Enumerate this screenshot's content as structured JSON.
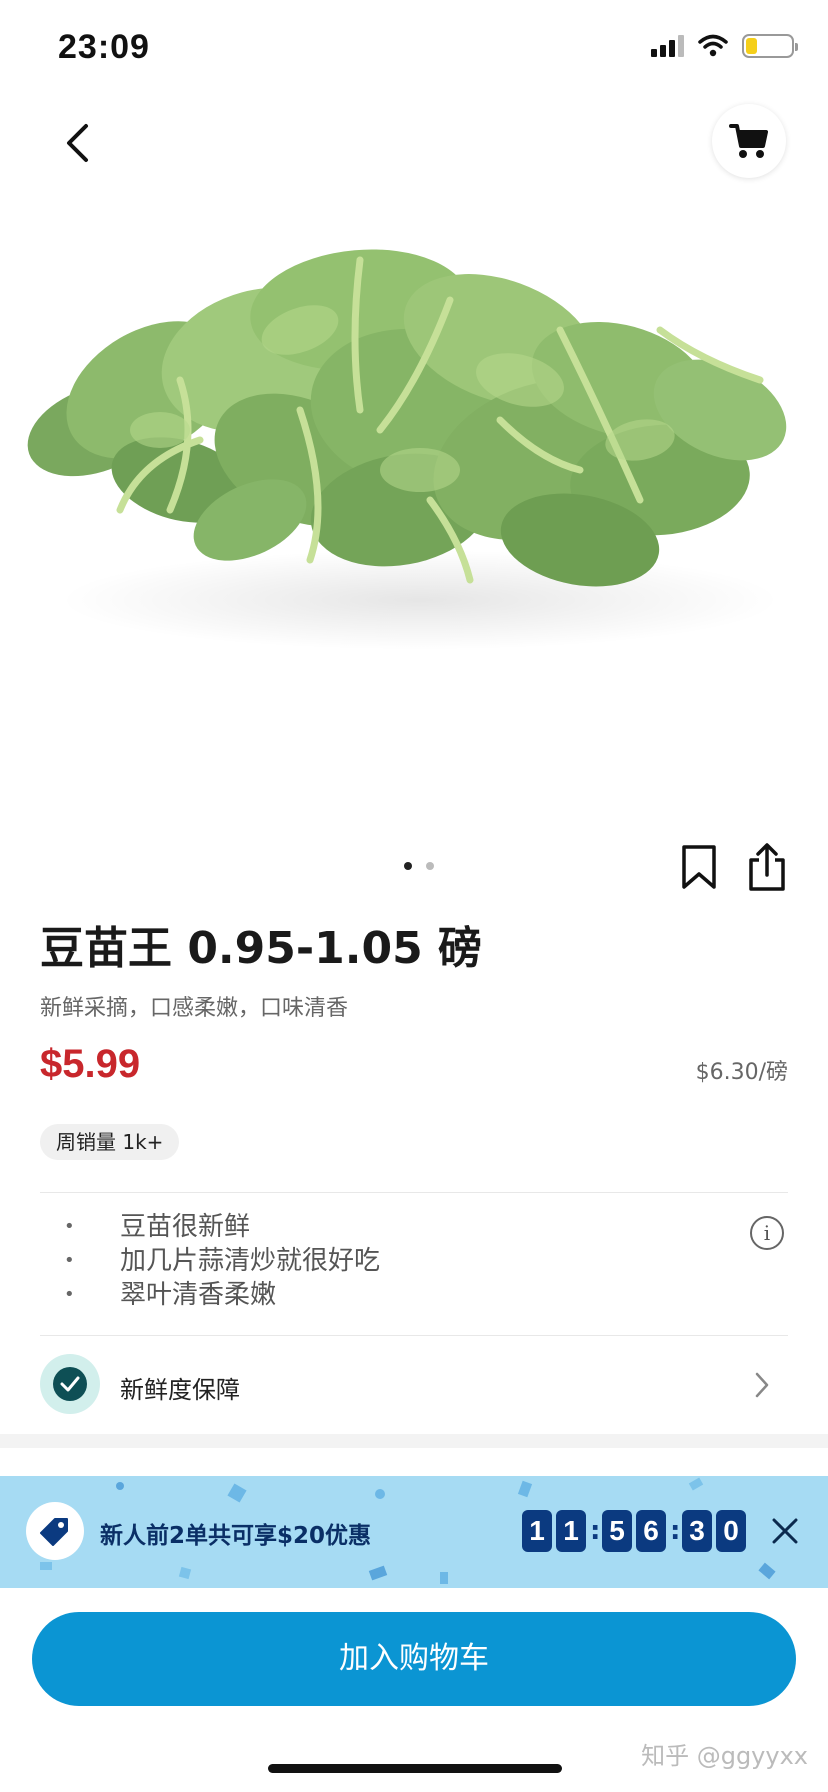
{
  "status_bar": {
    "time": "23:09",
    "icons": [
      "signal-icon",
      "wifi-icon",
      "battery-icon"
    ],
    "battery_level": 0.25,
    "battery_color": "#f5cf1a"
  },
  "nav": {
    "back_icon": "chevron-left-icon",
    "cart_icon": "shopping-cart-icon"
  },
  "product": {
    "image": "pea-shoots-photo",
    "image_count": 2,
    "image_index": 1,
    "title": "豆苗王 0.95-1.05 磅",
    "subtitle": "新鲜采摘，口感柔嫩，口味清香",
    "price": "$5.99",
    "price_color": "#c8272c",
    "unit_price": "$6.30/磅",
    "sales_badge": "周销量 1k+",
    "features": [
      "豆苗很新鲜",
      "加几片蒜清炒就很好吃",
      "翠叶清香柔嫩"
    ],
    "freshness": "新鲜度保障"
  },
  "promo": {
    "text": "新人前2单共可享$20优惠",
    "countdown": {
      "hours": [
        "1",
        "1"
      ],
      "minutes": [
        "5",
        "6"
      ],
      "seconds": [
        "3",
        "0"
      ]
    },
    "background": "#a6dbf3"
  },
  "actions": {
    "add_to_cart": "加入购物车",
    "button_color": "#0b95d3"
  },
  "watermark": "知乎 @ggyyxx"
}
